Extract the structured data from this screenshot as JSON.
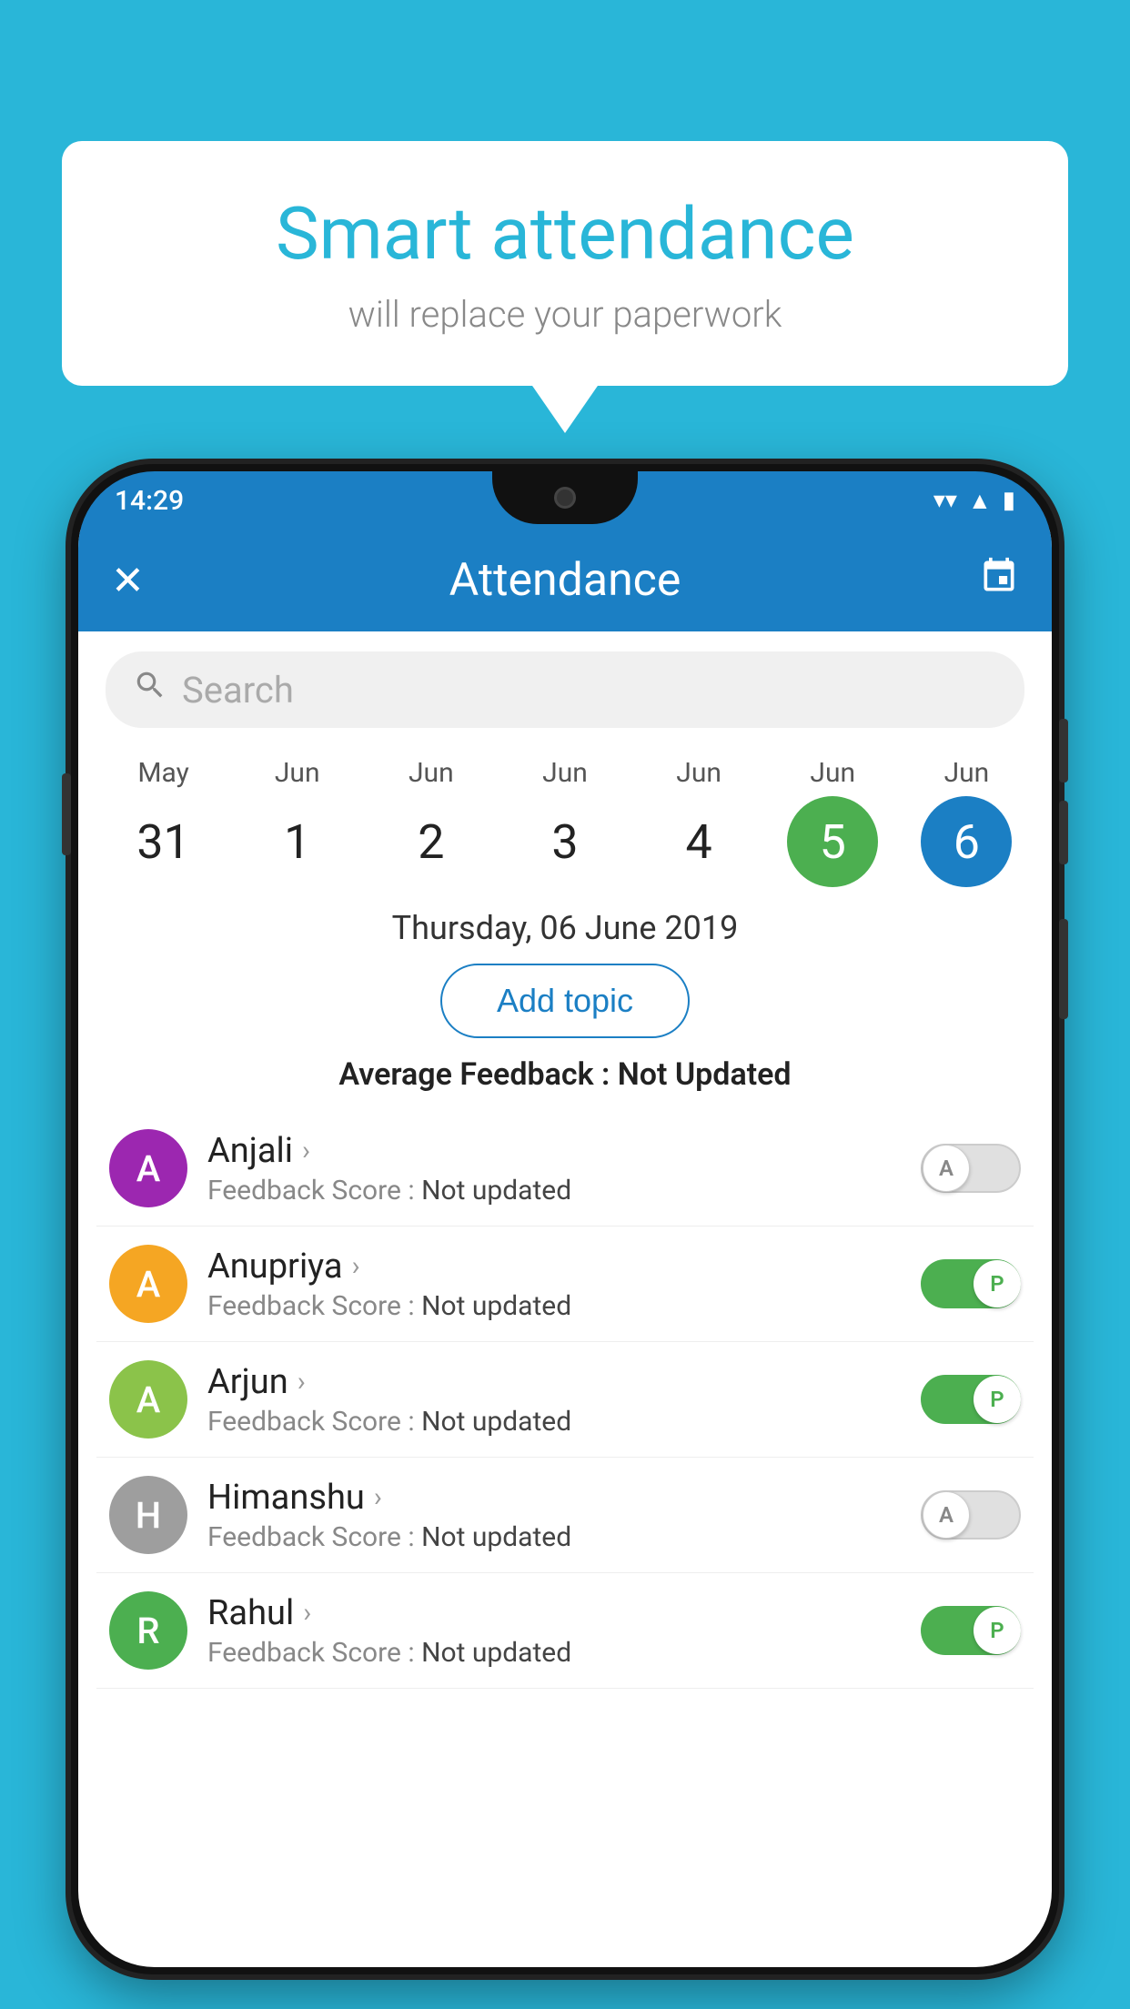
{
  "background_color": "#29B6D8",
  "speech_bubble": {
    "title": "Smart attendance",
    "subtitle": "will replace your paperwork"
  },
  "status_bar": {
    "time": "14:29",
    "wifi_icon": "▼",
    "signal_icon": "▲",
    "battery_icon": "▮"
  },
  "header": {
    "title": "Attendance",
    "close_label": "✕",
    "calendar_label": "📅"
  },
  "search": {
    "placeholder": "Search"
  },
  "dates": [
    {
      "month": "May",
      "day": "31",
      "state": "normal"
    },
    {
      "month": "Jun",
      "day": "1",
      "state": "normal"
    },
    {
      "month": "Jun",
      "day": "2",
      "state": "normal"
    },
    {
      "month": "Jun",
      "day": "3",
      "state": "normal"
    },
    {
      "month": "Jun",
      "day": "4",
      "state": "normal"
    },
    {
      "month": "Jun",
      "day": "5",
      "state": "today"
    },
    {
      "month": "Jun",
      "day": "6",
      "state": "selected"
    }
  ],
  "selected_date": "Thursday, 06 June 2019",
  "add_topic_label": "Add topic",
  "avg_feedback_label": "Average Feedback :",
  "avg_feedback_value": "Not Updated",
  "students": [
    {
      "name": "Anjali",
      "initial": "A",
      "avatar_color": "#9C27B0",
      "feedback_label": "Feedback Score :",
      "feedback_value": "Not updated",
      "attendance": "absent",
      "toggle_letter": "A"
    },
    {
      "name": "Anupriya",
      "initial": "A",
      "avatar_color": "#F5A623",
      "feedback_label": "Feedback Score :",
      "feedback_value": "Not updated",
      "attendance": "present",
      "toggle_letter": "P"
    },
    {
      "name": "Arjun",
      "initial": "A",
      "avatar_color": "#8BC34A",
      "feedback_label": "Feedback Score :",
      "feedback_value": "Not updated",
      "attendance": "present",
      "toggle_letter": "P"
    },
    {
      "name": "Himanshu",
      "initial": "H",
      "avatar_color": "#9E9E9E",
      "feedback_label": "Feedback Score :",
      "feedback_value": "Not updated",
      "attendance": "absent",
      "toggle_letter": "A"
    },
    {
      "name": "Rahul",
      "initial": "R",
      "avatar_color": "#4CAF50",
      "feedback_label": "Feedback Score :",
      "feedback_value": "Not updated",
      "attendance": "present",
      "toggle_letter": "P"
    }
  ]
}
